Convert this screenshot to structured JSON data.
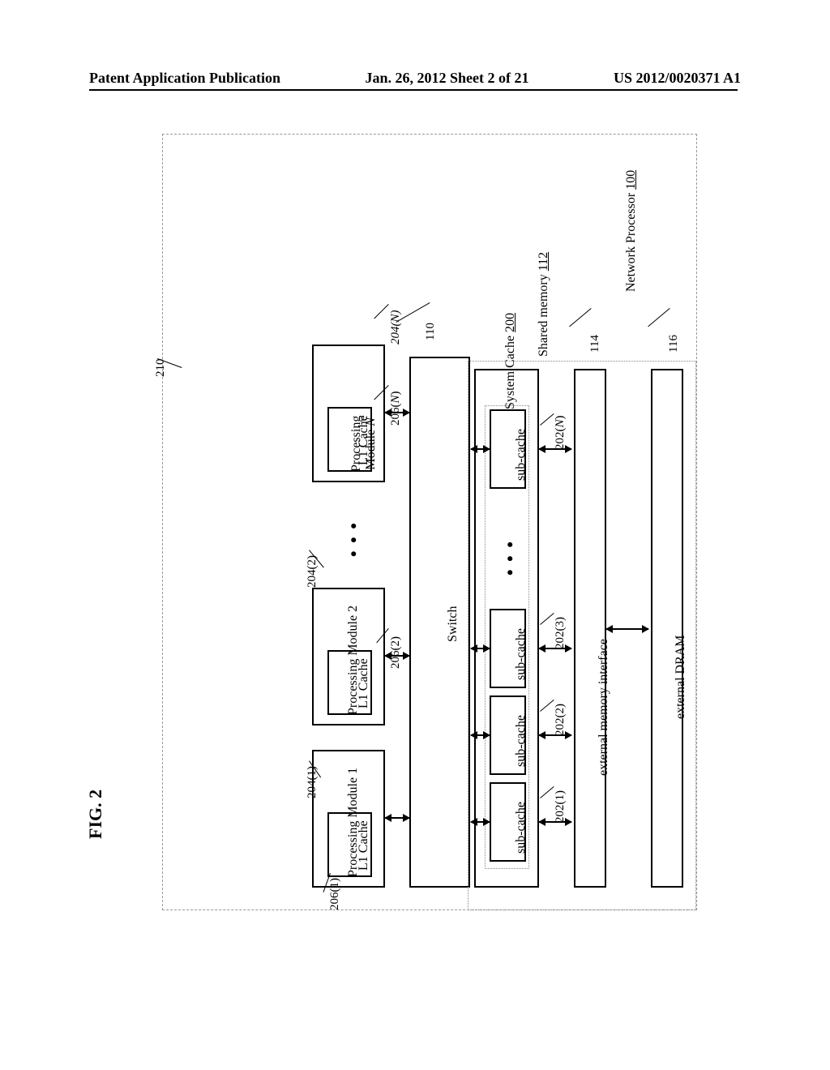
{
  "header": {
    "left": "Patent Application Publication",
    "center": "Jan. 26, 2012  Sheet 2 of 21",
    "right": "US 2012/0020371 A1"
  },
  "figure": {
    "label": "FIG. 2",
    "network_processor": {
      "label": "Network Processor",
      "ref": "100"
    },
    "processing_modules": [
      {
        "label": "Processing Module 1",
        "ref": "204(1)",
        "l1": {
          "label": "L1 Cache",
          "ref": "206(1)"
        }
      },
      {
        "label": "Processing Module 2",
        "ref": "204(2)",
        "l1": {
          "label": "L1 Cache",
          "ref": "206(2)"
        }
      },
      {
        "label": "Processing Module N",
        "ref": "204(N)",
        "l1": {
          "label": "L1 Cache",
          "ref": "206(N)"
        }
      }
    ],
    "switch": {
      "label": "Switch",
      "ref": "110"
    },
    "shared_memory": {
      "label": "Shared memory",
      "ref": "112"
    },
    "system_cache": {
      "label": "System Cache",
      "ref": "200"
    },
    "subcaches": [
      {
        "label": "sub-cache",
        "ref": "202(1)"
      },
      {
        "label": "sub-cache",
        "ref": "202(2)"
      },
      {
        "label": "sub-cache",
        "ref": "202(3)"
      },
      {
        "label": "sub-cache",
        "ref": "202(N)"
      }
    ],
    "emi": {
      "label": "external memory interface",
      "ref": "114"
    },
    "dram": {
      "label": "external DRAM",
      "ref": "116"
    },
    "boundary_ref": "210"
  }
}
